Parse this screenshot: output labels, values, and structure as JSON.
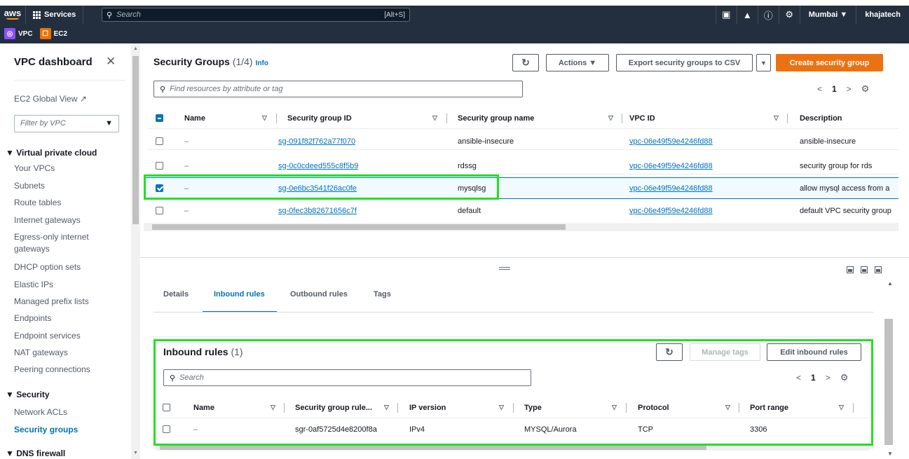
{
  "nav": {
    "logo": "aws",
    "services_label": "Services",
    "search_placeholder": "Search",
    "search_shortcut": "[Alt+S]",
    "region": "Mumbai ▼",
    "user": "khajatech"
  },
  "favorites": [
    {
      "label": "VPC",
      "color": "#8c4fff",
      "icon": "vpc-icon"
    },
    {
      "label": "EC2",
      "color": "#ed7100",
      "icon": "ec2-icon"
    }
  ],
  "sidebar": {
    "title": "VPC dashboard",
    "global_view": "EC2 Global View",
    "filter_placeholder": "Filter by VPC",
    "section_vpc": "Virtual private cloud",
    "vpc_items": [
      "Your VPCs",
      "Subnets",
      "Route tables",
      "Internet gateways",
      "Egress-only internet gateways",
      "DHCP option sets",
      "Elastic IPs",
      "Managed prefix lists",
      "Endpoints",
      "Endpoint services",
      "NAT gateways",
      "Peering connections"
    ],
    "section_security": "Security",
    "security_items": [
      "Network ACLs",
      "Security groups"
    ],
    "section_dns": "DNS firewall"
  },
  "sg": {
    "title": "Security Groups",
    "count": "(1/4)",
    "info": "Info",
    "actions_label": "Actions ▼",
    "export_label": "Export security groups to CSV",
    "create_label": "Create security group",
    "search_placeholder": "Find resources by attribute or tag",
    "page": "1",
    "columns": [
      "Name",
      "Security group ID",
      "Security group name",
      "VPC ID",
      "Description"
    ],
    "rows": [
      {
        "name": "–",
        "id": "sg-091f82f762a77f070",
        "group_name": "ansible-insecure",
        "vpc": "vpc-06e49f59e4246fd88",
        "desc": "ansible-insecure",
        "selected": false
      },
      {
        "name": "–",
        "id": "sg-0c0cdeed555c8f5b9",
        "group_name": "rdssg",
        "vpc": "vpc-06e49f59e4246fd88",
        "desc": "security group for rds",
        "selected": false
      },
      {
        "name": "–",
        "id": "sg-0e6bc3541f26ac0fe",
        "group_name": "mysqlsg",
        "vpc": "vpc-06e49f59e4246fd88",
        "desc": "allow mysql access from a",
        "selected": true
      },
      {
        "name": "–",
        "id": "sg-0fec3b82671656c7f",
        "group_name": "default",
        "vpc": "vpc-06e49f59e4246fd88",
        "desc": "default VPC security group",
        "selected": false
      }
    ]
  },
  "details": {
    "tabs": [
      "Details",
      "Inbound rules",
      "Outbound rules",
      "Tags"
    ],
    "active_tab": "Inbound rules"
  },
  "inbound": {
    "title": "Inbound rules",
    "count": "(1)",
    "manage_tags": "Manage tags",
    "edit_label": "Edit inbound rules",
    "search_placeholder": "Search",
    "page": "1",
    "columns": [
      "Name",
      "Security group rule...",
      "IP version",
      "Type",
      "Protocol",
      "Port range"
    ],
    "rows": [
      {
        "name": "–",
        "rule_id": "sgr-0af5725d4e8200f8a",
        "ip": "IPv4",
        "type": "MYSQL/Aurora",
        "protocol": "TCP",
        "port": "3306"
      }
    ]
  },
  "colors": {
    "accent": "#0073bb",
    "create": "#ec7211",
    "highlight": "#22e022",
    "nav": "#232f3e"
  }
}
